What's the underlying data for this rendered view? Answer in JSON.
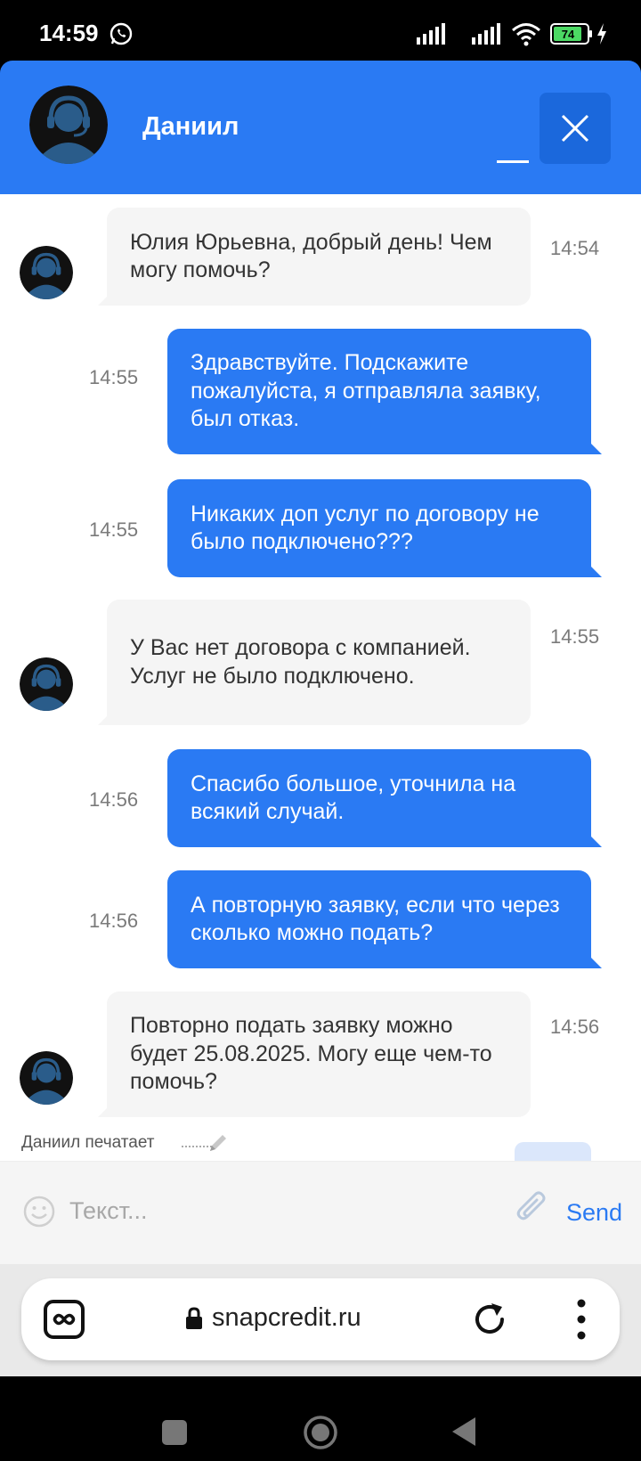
{
  "status_bar": {
    "time": "14:59",
    "battery_level": "74",
    "icons": [
      "whatsapp-icon",
      "signal-icon",
      "signal-icon",
      "wifi-icon",
      "battery-icon",
      "charging-icon"
    ]
  },
  "header": {
    "agent_name": "Даниил",
    "icons": [
      "agent-avatar",
      "minimize-icon",
      "close-icon"
    ]
  },
  "messages": [
    {
      "sender": "agent",
      "text": "Юлия Юрьевна, добрый день! Чем могу помочь?",
      "time": "14:54"
    },
    {
      "sender": "user",
      "text": "Здравствуйте. Подскажите пожалуйста, я отправляла заявку, был отказ.",
      "time": "14:55"
    },
    {
      "sender": "user",
      "text": "Никаких доп услуг по договору не было подключено???",
      "time": "14:55"
    },
    {
      "sender": "agent",
      "text": "У Вас нет договора с компанией. Услуг не было подключено.",
      "time": "14:55"
    },
    {
      "sender": "user",
      "text": "Спасибо большое, уточнила на всякий случай.",
      "time": "14:56"
    },
    {
      "sender": "user",
      "text": "А повторную заявку, если что через сколько можно подать?",
      "time": "14:56"
    },
    {
      "sender": "agent",
      "text": "Повторно подать заявку можно будет 25.08.2025. Могу еще чем-то помочь?",
      "time": "14:56"
    }
  ],
  "typing": {
    "text": "Даниил печатает"
  },
  "input": {
    "placeholder": "Текст...",
    "value": "",
    "send_label": "Send"
  },
  "browser": {
    "url": "snapcredit.ru"
  },
  "colors": {
    "accent": "#2a7af3",
    "agent_bubble": "#f5f5f5",
    "header_close_bg": "#1b68dc"
  }
}
